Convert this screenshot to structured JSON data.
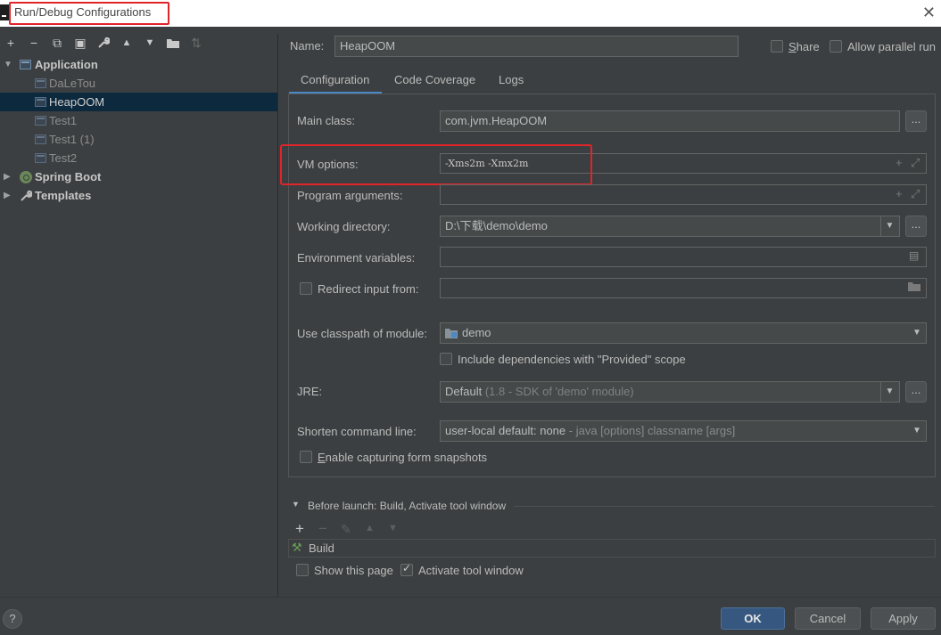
{
  "window": {
    "title": "Run/Debug Configurations",
    "close_glyph": "✕"
  },
  "toolbar": {
    "add": "+",
    "remove": "−",
    "copy": "⧉",
    "save": "▣",
    "edit": "🔧",
    "up": "▲",
    "down": "▼",
    "folder": "▪",
    "sort": "⇅"
  },
  "tree": {
    "application": "Application",
    "items": [
      "DaLeTou",
      "HeapOOM",
      "Test1",
      "Test1 (1)",
      "Test2"
    ],
    "spring_boot": "Spring Boot",
    "templates": "Templates"
  },
  "header": {
    "name_label": "Name:",
    "name_value": "HeapOOM",
    "share_label": "Share",
    "allow_parallel_label": "Allow parallel run"
  },
  "tabs": [
    "Configuration",
    "Code Coverage",
    "Logs"
  ],
  "form": {
    "main_class_label": "Main class:",
    "main_class_value": "com.jvm.HeapOOM",
    "vm_options_label": "VM options:",
    "vm_options_value": "-Xms2m -Xmx2m",
    "program_args_label": "Program arguments:",
    "program_args_value": "",
    "working_dir_label": "Working directory:",
    "working_dir_value": "D:\\下载\\demo\\demo",
    "env_vars_label": "Environment variables:",
    "env_vars_value": "",
    "redirect_label": "Redirect input from:",
    "redirect_value": "",
    "classpath_label": "Use classpath of module:",
    "classpath_value": "demo",
    "include_deps_label": "Include dependencies with \"Provided\" scope",
    "jre_label": "JRE:",
    "jre_value_main": "Default",
    "jre_value_detail": "(1.8 - SDK of 'demo' module)",
    "shorten_label": "Shorten command line:",
    "shorten_value_main": "user-local default: none",
    "shorten_value_detail": "- java [options] classname [args]",
    "capture_label": "Enable capturing form snapshots",
    "dots": "..."
  },
  "before_launch": {
    "title": "Before launch: Build, Activate tool window",
    "build_item": "Build",
    "show_page_label": "Show this page",
    "activate_label": "Activate tool window"
  },
  "buttons": {
    "help": "?",
    "ok": "OK",
    "cancel": "Cancel",
    "apply": "Apply"
  }
}
